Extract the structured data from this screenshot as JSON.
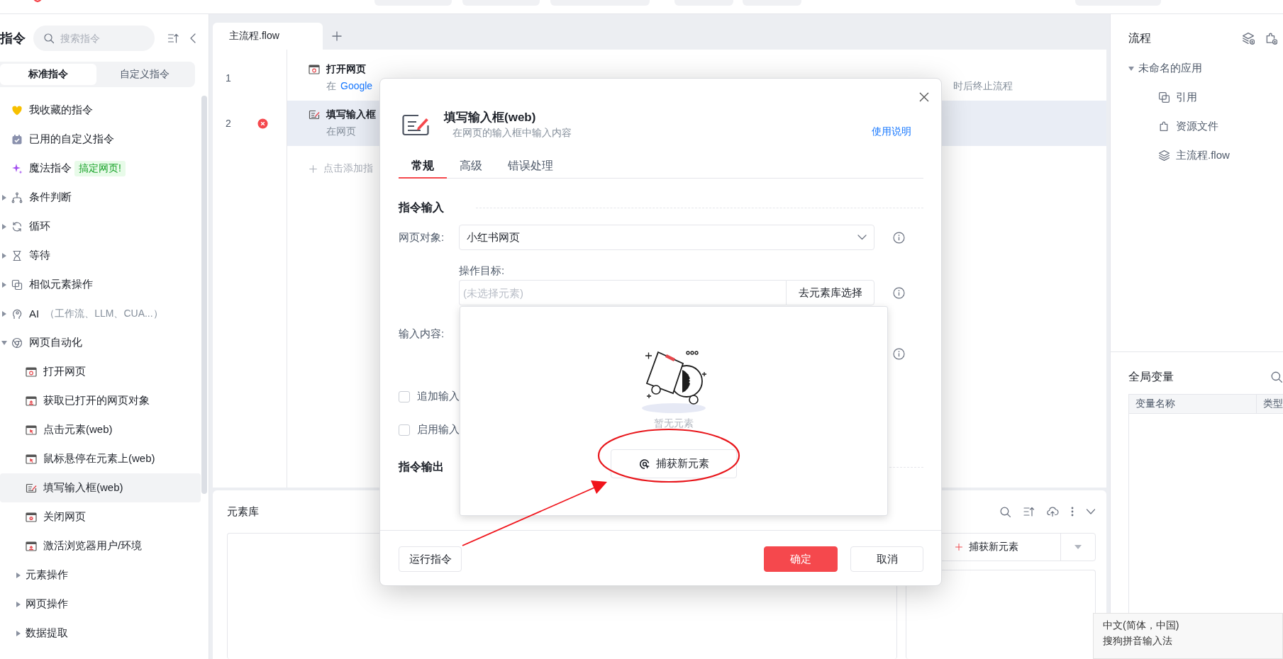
{
  "sidebar": {
    "title": "指令",
    "search": {
      "placeholder": "搜索指令"
    },
    "tabs": [
      {
        "label": "标准指令",
        "selected": true
      },
      {
        "label": "自定义指令",
        "selected": false
      }
    ],
    "items": [
      {
        "kind": "entry",
        "label": "我收藏的指令",
        "selected": false
      },
      {
        "kind": "entry",
        "label": "已用的自定义指令",
        "selected": false
      },
      {
        "kind": "entry",
        "label": "魔法指令",
        "badge": "搞定网页!",
        "selected": false
      },
      {
        "kind": "group",
        "label": "条件判断",
        "expanded": false,
        "selected": false
      },
      {
        "kind": "group",
        "label": "循环",
        "expanded": false,
        "selected": false
      },
      {
        "kind": "group",
        "label": "等待",
        "expanded": false,
        "selected": false
      },
      {
        "kind": "group",
        "label": "相似元素操作",
        "expanded": false,
        "selected": false
      },
      {
        "kind": "group",
        "label": "AI",
        "hint": "（工作流、LLM、CUA...）",
        "expanded": false,
        "selected": false
      },
      {
        "kind": "group",
        "label": "网页自动化",
        "expanded": true,
        "selected": false,
        "children": [
          {
            "kind": "entry",
            "label": "打开网页",
            "selected": false
          },
          {
            "kind": "entry",
            "label": "获取已打开的网页对象",
            "selected": false
          },
          {
            "kind": "entry",
            "label": "点击元素(web)",
            "selected": false
          },
          {
            "kind": "entry",
            "label": "鼠标悬停在元素上(web)",
            "selected": false
          },
          {
            "kind": "entry",
            "label": "填写输入框(web)",
            "selected": true
          },
          {
            "kind": "entry",
            "label": "关闭网页",
            "selected": false
          },
          {
            "kind": "entry",
            "label": "激活浏览器用户/环境",
            "selected": false
          },
          {
            "kind": "group",
            "label": "元素操作",
            "expanded": false,
            "selected": false
          },
          {
            "kind": "group",
            "label": "网页操作",
            "expanded": false,
            "selected": false
          },
          {
            "kind": "group",
            "label": "数据提取",
            "expanded": false,
            "selected": false
          }
        ]
      }
    ]
  },
  "flow": {
    "tabs": [
      {
        "label": "主流程.flow",
        "selected": true
      }
    ],
    "steps": [
      {
        "number": "1",
        "title": "打开网页",
        "description": [
          {
            "kind": "text",
            "text": "在"
          },
          {
            "kind": "link",
            "text": "Google"
          }
        ],
        "trailing": "时后终止流程",
        "error": false,
        "selected": false
      },
      {
        "number": "2",
        "title": "填写输入框",
        "description": [
          {
            "kind": "text",
            "text": "在网页"
          }
        ],
        "error": true,
        "selected": true
      }
    ],
    "add_hint": "点击添加指"
  },
  "element_library": {
    "title": "元素库",
    "capture_button": "捕获新元素"
  },
  "right_panel": {
    "title": "流程",
    "tree": [
      {
        "label": "未命名的应用",
        "expanded": true,
        "children": [
          {
            "label": "引用"
          },
          {
            "label": "资源文件"
          },
          {
            "label": "主流程.flow"
          }
        ]
      }
    ],
    "variables": {
      "title": "全局变量",
      "columns": [
        "变量名称",
        "类型"
      ]
    }
  },
  "dialog": {
    "title": "填写输入框(web)",
    "subtitle": "在网页的输入框中输入内容",
    "help_link": "使用说明",
    "tabs": [
      {
        "label": "常规",
        "selected": true
      },
      {
        "label": "高级",
        "selected": false
      },
      {
        "label": "错误处理",
        "selected": false
      }
    ],
    "input_section": "指令输入",
    "page_object": {
      "label": "网页对象:",
      "value": "小红书网页"
    },
    "target": {
      "label": "操作目标:",
      "placeholder": "(未选择元素)",
      "button": "去元素库选择"
    },
    "content": {
      "label": "输入内容:"
    },
    "options": [
      {
        "label": "追加输入",
        "checked": false
      },
      {
        "label": "启用输入",
        "checked": false
      }
    ],
    "output_section": "指令输出",
    "element_popup": {
      "empty_text": "暂无元素",
      "capture_button": "捕获新元素"
    },
    "run_button": "运行指令",
    "confirm_button": "确定",
    "cancel_button": "取消"
  },
  "ime": {
    "language": "中文(简体，中国)",
    "method": "搜狗拼音输入法"
  }
}
